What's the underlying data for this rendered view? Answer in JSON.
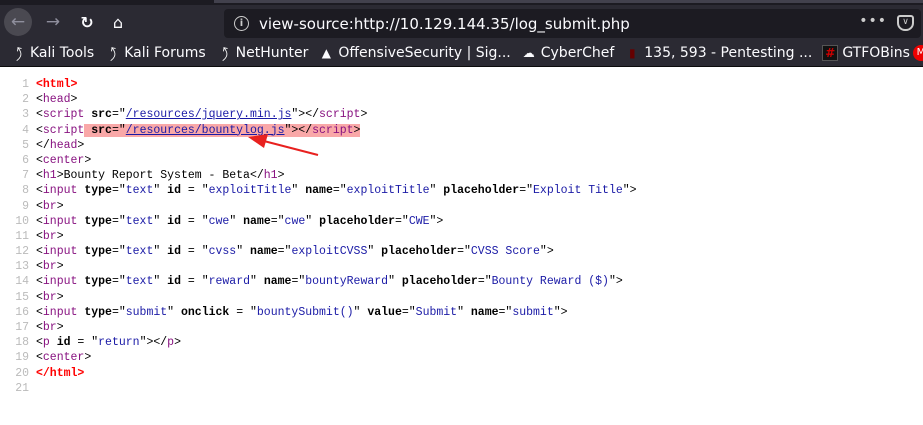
{
  "browser": {
    "url": "view-source:http://10.129.144.35/log_submit.php",
    "icons": {
      "back": "back-arrow-icon",
      "forward": "forward-arrow-icon",
      "reload": "reload-icon",
      "home": "home-icon",
      "info": "info-icon",
      "more": "more-dots-icon",
      "pocket": "pocket-icon"
    },
    "bookmarks": [
      {
        "label": "Kali Tools",
        "icon": "kali-dragon-icon"
      },
      {
        "label": "Kali Forums",
        "icon": "kali-dragon-icon"
      },
      {
        "label": "NetHunter",
        "icon": "kali-dragon-icon"
      },
      {
        "label": "OffensiveSecurity | Sig...",
        "icon": "offsec-icon"
      },
      {
        "label": "CyberChef",
        "icon": "chef-hat-icon"
      },
      {
        "label": "135, 593 - Pentesting ...",
        "icon": "book-icon"
      },
      {
        "label": "GTFOBins",
        "icon": "gtfobins-icon"
      }
    ]
  },
  "annotation": {
    "highlight_line": 4,
    "arrow_color": "#e8211f",
    "highlight_color": "#f9a8a8"
  },
  "source_lines": [
    [
      [
        "r",
        "<html>"
      ]
    ],
    [
      [
        "p",
        "<"
      ],
      [
        "t",
        "head"
      ],
      [
        "p",
        ">"
      ]
    ],
    [
      [
        "p",
        "<"
      ],
      [
        "t",
        "script"
      ],
      [
        "p",
        " "
      ],
      [
        "a",
        "src"
      ],
      [
        "p",
        "=\""
      ],
      [
        "l",
        "/resources/jquery.min.js"
      ],
      [
        "p",
        "\"></"
      ],
      [
        "t",
        "script"
      ],
      [
        "p",
        ">"
      ]
    ],
    [
      [
        "p",
        "<"
      ],
      [
        "t",
        "script"
      ],
      [
        "p",
        " "
      ],
      [
        "a",
        "src"
      ],
      [
        "p",
        "=\""
      ],
      [
        "l",
        "/resources/bountylog.js"
      ],
      [
        "p",
        "\"></"
      ],
      [
        "t",
        "script"
      ],
      [
        "p",
        ">"
      ]
    ],
    [
      [
        "p",
        "</"
      ],
      [
        "t",
        "head"
      ],
      [
        "p",
        ">"
      ]
    ],
    [
      [
        "p",
        "<"
      ],
      [
        "t",
        "center"
      ],
      [
        "p",
        ">"
      ]
    ],
    [
      [
        "p",
        "<"
      ],
      [
        "t",
        "h1"
      ],
      [
        "p",
        ">Bounty Report System - Beta</"
      ],
      [
        "t",
        "h1"
      ],
      [
        "p",
        ">"
      ]
    ],
    [
      [
        "p",
        "<"
      ],
      [
        "t",
        "input"
      ],
      [
        "p",
        " "
      ],
      [
        "a",
        "type"
      ],
      [
        "p",
        "=\""
      ],
      [
        "v",
        "text"
      ],
      [
        "p",
        "\" "
      ],
      [
        "a",
        "id"
      ],
      [
        "p",
        " = \""
      ],
      [
        "v",
        "exploitTitle"
      ],
      [
        "p",
        "\" "
      ],
      [
        "a",
        "name"
      ],
      [
        "p",
        "=\""
      ],
      [
        "v",
        "exploitTitle"
      ],
      [
        "p",
        "\" "
      ],
      [
        "a",
        "placeholder"
      ],
      [
        "p",
        "=\""
      ],
      [
        "v",
        "Exploit Title"
      ],
      [
        "p",
        "\">"
      ]
    ],
    [
      [
        "p",
        "<"
      ],
      [
        "t",
        "br"
      ],
      [
        "p",
        ">"
      ]
    ],
    [
      [
        "p",
        "<"
      ],
      [
        "t",
        "input"
      ],
      [
        "p",
        " "
      ],
      [
        "a",
        "type"
      ],
      [
        "p",
        "=\""
      ],
      [
        "v",
        "text"
      ],
      [
        "p",
        "\" "
      ],
      [
        "a",
        "id"
      ],
      [
        "p",
        " = \""
      ],
      [
        "v",
        "cwe"
      ],
      [
        "p",
        "\" "
      ],
      [
        "a",
        "name"
      ],
      [
        "p",
        "=\""
      ],
      [
        "v",
        "cwe"
      ],
      [
        "p",
        "\" "
      ],
      [
        "a",
        "placeholder"
      ],
      [
        "p",
        "=\""
      ],
      [
        "v",
        "CWE"
      ],
      [
        "p",
        "\">"
      ]
    ],
    [
      [
        "p",
        "<"
      ],
      [
        "t",
        "br"
      ],
      [
        "p",
        ">"
      ]
    ],
    [
      [
        "p",
        "<"
      ],
      [
        "t",
        "input"
      ],
      [
        "p",
        " "
      ],
      [
        "a",
        "type"
      ],
      [
        "p",
        "=\""
      ],
      [
        "v",
        "text"
      ],
      [
        "p",
        "\" "
      ],
      [
        "a",
        "id"
      ],
      [
        "p",
        " = \""
      ],
      [
        "v",
        "cvss"
      ],
      [
        "p",
        "\" "
      ],
      [
        "a",
        "name"
      ],
      [
        "p",
        "=\""
      ],
      [
        "v",
        "exploitCVSS"
      ],
      [
        "p",
        "\" "
      ],
      [
        "a",
        "placeholder"
      ],
      [
        "p",
        "=\""
      ],
      [
        "v",
        "CVSS Score"
      ],
      [
        "p",
        "\">"
      ]
    ],
    [
      [
        "p",
        "<"
      ],
      [
        "t",
        "br"
      ],
      [
        "p",
        ">"
      ]
    ],
    [
      [
        "p",
        "<"
      ],
      [
        "t",
        "input"
      ],
      [
        "p",
        " "
      ],
      [
        "a",
        "type"
      ],
      [
        "p",
        "=\""
      ],
      [
        "v",
        "text"
      ],
      [
        "p",
        "\" "
      ],
      [
        "a",
        "id"
      ],
      [
        "p",
        " = \""
      ],
      [
        "v",
        "reward"
      ],
      [
        "p",
        "\" "
      ],
      [
        "a",
        "name"
      ],
      [
        "p",
        "=\""
      ],
      [
        "v",
        "bountyReward"
      ],
      [
        "p",
        "\" "
      ],
      [
        "a",
        "placeholder"
      ],
      [
        "p",
        "=\""
      ],
      [
        "v",
        "Bounty Reward ($)"
      ],
      [
        "p",
        "\">"
      ]
    ],
    [
      [
        "p",
        "<"
      ],
      [
        "t",
        "br"
      ],
      [
        "p",
        ">"
      ]
    ],
    [
      [
        "p",
        "<"
      ],
      [
        "t",
        "input"
      ],
      [
        "p",
        " "
      ],
      [
        "a",
        "type"
      ],
      [
        "p",
        "=\""
      ],
      [
        "v",
        "submit"
      ],
      [
        "p",
        "\" "
      ],
      [
        "a",
        "onclick"
      ],
      [
        "p",
        " = \""
      ],
      [
        "v",
        "bountySubmit()"
      ],
      [
        "p",
        "\" "
      ],
      [
        "a",
        "value"
      ],
      [
        "p",
        "=\""
      ],
      [
        "v",
        "Submit"
      ],
      [
        "p",
        "\" "
      ],
      [
        "a",
        "name"
      ],
      [
        "p",
        "=\""
      ],
      [
        "v",
        "submit"
      ],
      [
        "p",
        "\">"
      ]
    ],
    [
      [
        "p",
        "<"
      ],
      [
        "t",
        "br"
      ],
      [
        "p",
        ">"
      ]
    ],
    [
      [
        "p",
        "<"
      ],
      [
        "t",
        "p"
      ],
      [
        "p",
        " "
      ],
      [
        "a",
        "id"
      ],
      [
        "p",
        " = \""
      ],
      [
        "v",
        "return"
      ],
      [
        "p",
        "\"></"
      ],
      [
        "t",
        "p"
      ],
      [
        "p",
        ">"
      ]
    ],
    [
      [
        "p",
        "<"
      ],
      [
        "t",
        "center"
      ],
      [
        "p",
        ">"
      ]
    ],
    [
      [
        "r",
        "</html>"
      ]
    ],
    []
  ]
}
